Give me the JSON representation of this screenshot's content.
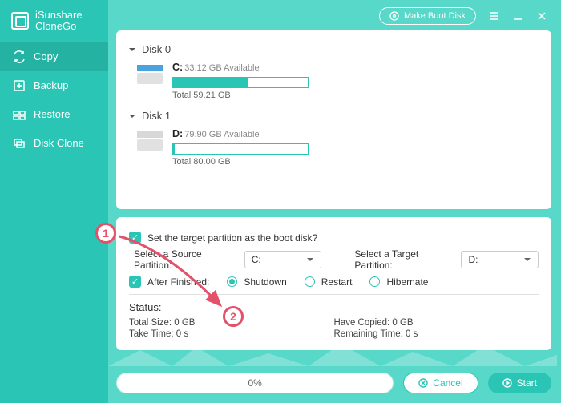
{
  "app": {
    "brand1": "iSunshare",
    "brand2": "CloneGo",
    "boot_btn": "Make Boot Disk"
  },
  "nav": {
    "copy": "Copy",
    "backup": "Backup",
    "restore": "Restore",
    "diskclone": "Disk Clone"
  },
  "disks": [
    {
      "header": "Disk 0",
      "letter": "C:",
      "avail": "33.12 GB Available",
      "total": "Total 59.21 GB",
      "fill_pct": 56,
      "win": true
    },
    {
      "header": "Disk 1",
      "letter": "D:",
      "avail": "79.90 GB Available",
      "total": "Total 80.00 GB",
      "fill_pct": 1,
      "win": false
    }
  ],
  "opts": {
    "set_target_boot": "Set the target partition as the boot disk?",
    "source_label": "Select a Source Partition:",
    "source_value": "C:",
    "target_label": "Select a Target Partition:",
    "target_value": "D:",
    "after_label": "After Finished:",
    "radio_shutdown": "Shutdown",
    "radio_restart": "Restart",
    "radio_hibernate": "Hibernate"
  },
  "status": {
    "title": "Status:",
    "total_size": "Total Size: 0 GB",
    "take_time": "Take Time: 0 s",
    "have_copied": "Have Copied: 0 GB",
    "remaining": "Remaining Time: 0 s"
  },
  "bottom": {
    "progress": "0%",
    "cancel": "Cancel",
    "start": "Start"
  },
  "callouts": {
    "c1": "1",
    "c2": "2"
  }
}
